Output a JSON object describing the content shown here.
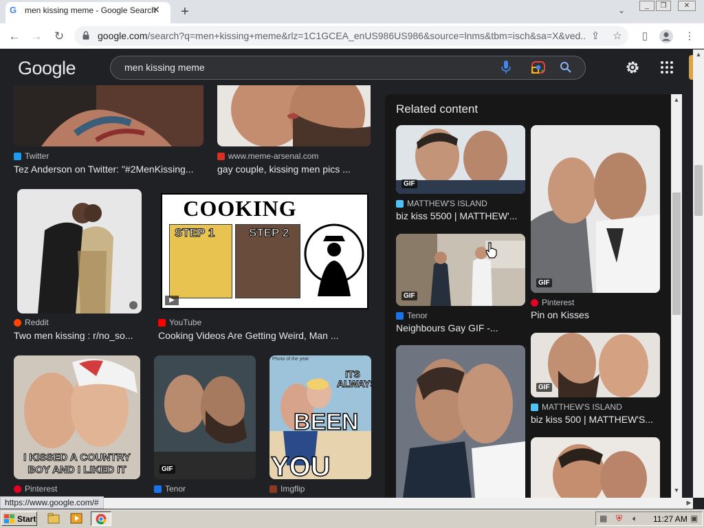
{
  "browser": {
    "tab_title": "men kissing meme - Google Search",
    "tab_favicon": "G",
    "url_host": "google.com",
    "url_rest": "/search?q=men+kissing+meme&rlz=1C1GCEA_enUS986US986&source=lnms&tbm=isch&sa=X&ved...",
    "status_url": "https://www.google.com/#"
  },
  "google": {
    "logo": "Google",
    "query": "men kissing meme"
  },
  "results": [
    {
      "source": "Twitter",
      "title": "Tez Anderson on Twitter: \"#2MenKissing...",
      "fav_color": "#1d9bf0",
      "gif": false
    },
    {
      "source": "www.meme-arsenal.com",
      "title": "gay couple, kissing men pics ...",
      "fav_color": "#d93025",
      "gif": false
    },
    {
      "source": "Reddit",
      "title": "Two men kissing : r/no_so...",
      "fav_color": "#ff4500",
      "gif": false
    },
    {
      "source": "YouTube",
      "title": "Cooking Videos Are Getting Weird, Man ...",
      "fav_color": "#ff0000",
      "gif": false
    },
    {
      "source": "Pinterest",
      "title": "",
      "fav_color": "#e60023",
      "gif": false
    },
    {
      "source": "Tenor",
      "title": "",
      "fav_color": "#1a73e8",
      "gif": true
    },
    {
      "source": "Imgflip",
      "title": "",
      "fav_color": "#8b3a1f",
      "gif": false
    }
  ],
  "meme": {
    "cooking_text": "COOKING",
    "step1": "STEP 1",
    "step2": "STEP 2",
    "country_text_1": "I KISSED A COUNTRY",
    "country_text_2": "BOY AND I LIKED IT",
    "photo_of_year": "Photo of the year",
    "its_always": "ITS ALWAYS",
    "been": "BEEN",
    "you": "YOU"
  },
  "related": {
    "title": "Related content",
    "items": [
      {
        "source": "MATTHEW'S ISLAND",
        "title": "biz kiss 5500 | MATTHEW'...",
        "fav_color": "#4fc3f7",
        "gif": true
      },
      {
        "source": "Pinterest",
        "title": "Pin on Kisses",
        "fav_color": "#e60023",
        "gif": true
      },
      {
        "source": "Tenor",
        "title": "Neighbours Gay GIF -...",
        "fav_color": "#1a73e8",
        "gif": true
      },
      {
        "source": "MATTHEW'S ISLAND",
        "title": "biz kiss 500 | MATTHEW'S...",
        "fav_color": "#4fc3f7",
        "gif": true
      }
    ]
  },
  "gif_badge": "GIF",
  "taskbar": {
    "start": "Start",
    "clock": "11:27 AM"
  }
}
